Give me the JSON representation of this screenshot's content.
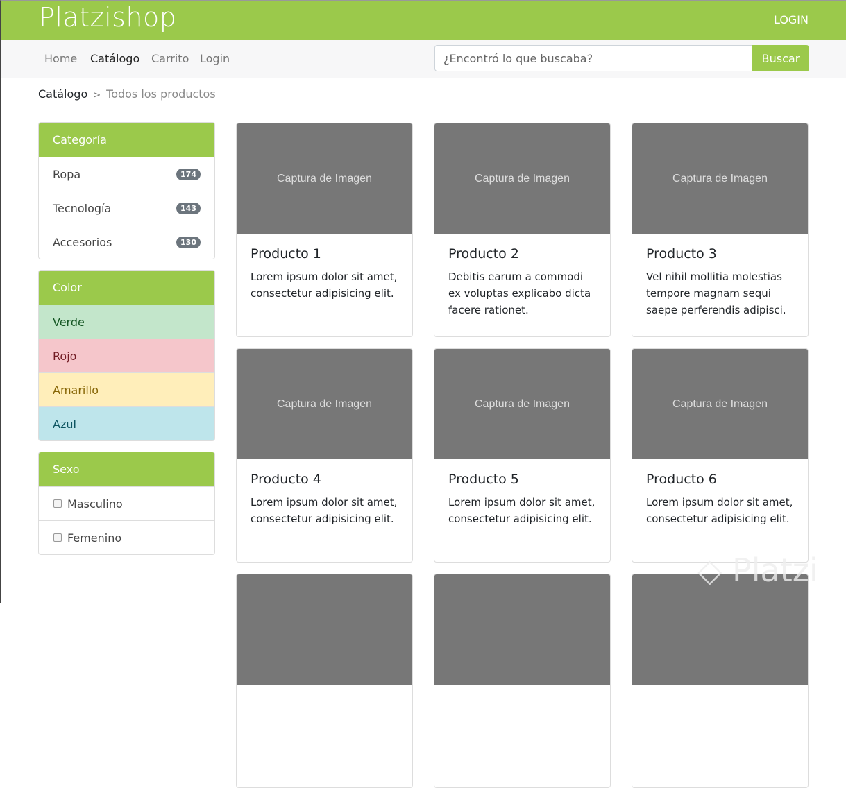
{
  "header": {
    "brand": "Platzishop",
    "login": "LOGIN"
  },
  "nav": {
    "items": [
      "Home",
      "Catálogo",
      "Carrito",
      "Login"
    ],
    "active": "Catálogo",
    "search_placeholder": "¿Encontró lo que buscaba?",
    "search_button": "Buscar"
  },
  "breadcrumb": {
    "parent": "Catálogo",
    "separator": ">",
    "current": "Todos los productos"
  },
  "sidebar": {
    "categoria": {
      "title": "Categoría",
      "items": [
        {
          "label": "Ropa",
          "count": "174"
        },
        {
          "label": "Tecnología",
          "count": "143"
        },
        {
          "label": "Accesorios",
          "count": "130"
        }
      ]
    },
    "color": {
      "title": "Color",
      "items": [
        {
          "label": "Verde",
          "bg": "#c3e6cb",
          "fg": "#155724"
        },
        {
          "label": "Rojo",
          "bg": "#f5c6cb",
          "fg": "#721c24"
        },
        {
          "label": "Amarillo",
          "bg": "#ffeeba",
          "fg": "#856404"
        },
        {
          "label": "Azul",
          "bg": "#bee5eb",
          "fg": "#0c5460"
        }
      ]
    },
    "sexo": {
      "title": "Sexo",
      "items": [
        "Masculino",
        "Femenino"
      ]
    }
  },
  "products": [
    {
      "image": "Captura de Imagen",
      "title": "Producto 1",
      "desc": "Lorem ipsum dolor sit amet, consectetur adipisicing elit."
    },
    {
      "image": "Captura de Imagen",
      "title": "Producto 2",
      "desc": "Debitis earum a commodi ex voluptas explicabo dicta facere rationet."
    },
    {
      "image": "Captura de Imagen",
      "title": "Producto 3",
      "desc": "Vel nihil mollitia molestias tempore magnam sequi saepe perferendis adipisci."
    },
    {
      "image": "Captura de Imagen",
      "title": "Producto 4",
      "desc": "Lorem ipsum dolor sit amet, consectetur adipisicing elit."
    },
    {
      "image": "Captura de Imagen",
      "title": "Producto 5",
      "desc": "Lorem ipsum dolor sit amet, consectetur adipisicing elit."
    },
    {
      "image": "Captura de Imagen",
      "title": "Producto 6",
      "desc": "Lorem ipsum dolor sit amet, consectetur adipisicing elit."
    },
    {
      "image": "",
      "title": "",
      "desc": ""
    },
    {
      "image": "",
      "title": "",
      "desc": ""
    },
    {
      "image": "",
      "title": "",
      "desc": ""
    }
  ],
  "watermark": "Platzi",
  "colors": {
    "brand": "#9bc94b",
    "image_placeholder": "#777777"
  }
}
